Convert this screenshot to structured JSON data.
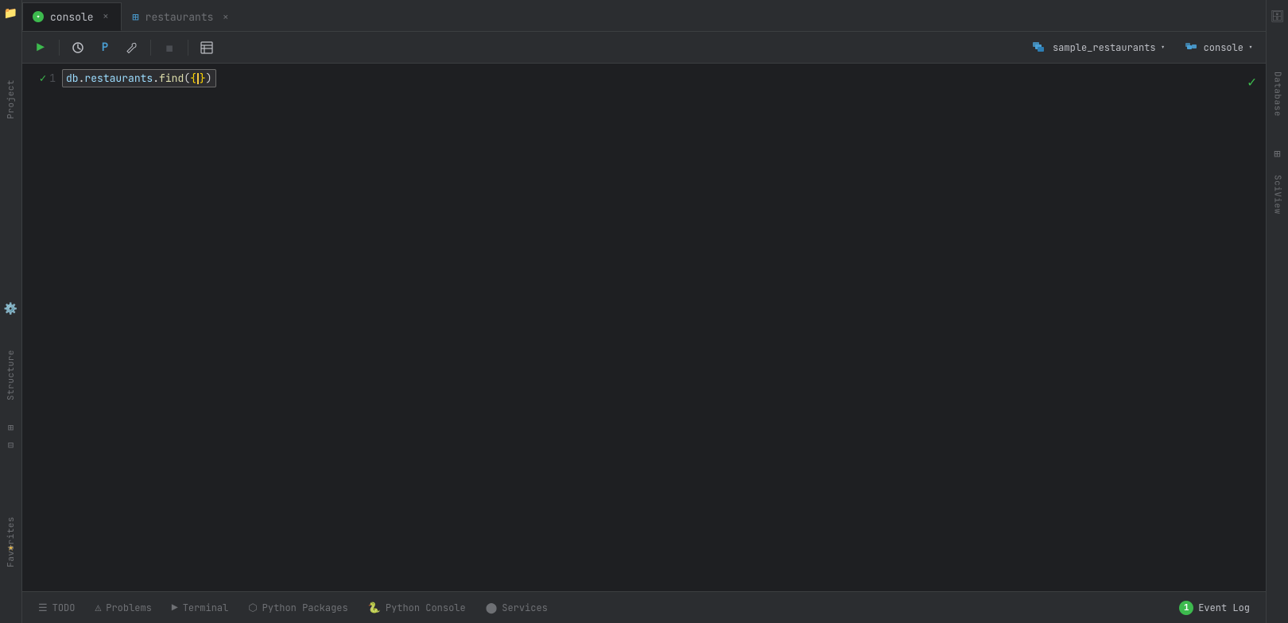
{
  "tabs": [
    {
      "id": "console",
      "label": "console",
      "icon": "console",
      "active": true
    },
    {
      "id": "restaurants",
      "label": "restaurants",
      "icon": "grid",
      "active": false
    }
  ],
  "toolbar": {
    "run_label": "▶",
    "history_label": "🕐",
    "python_label": "P",
    "wrench_label": "🔧",
    "stop_label": "⏹",
    "table_label": "☰",
    "db_selector": "sample_restaurants",
    "connection": "console"
  },
  "editor": {
    "line_number": "1",
    "code": "db.restaurants.find({})"
  },
  "left_panel": {
    "project_label": "Project",
    "structure_label": "Structure",
    "favorites_label": "Favorites"
  },
  "right_panel": {
    "database_label": "Database",
    "sciview_label": "SciView"
  },
  "status_bar": {
    "todo_label": "TODO",
    "problems_label": "Problems",
    "terminal_label": "Terminal",
    "python_packages_label": "Python Packages",
    "python_console_label": "Python Console",
    "services_label": "Services",
    "event_log_label": "Event Log",
    "event_log_count": "1"
  }
}
